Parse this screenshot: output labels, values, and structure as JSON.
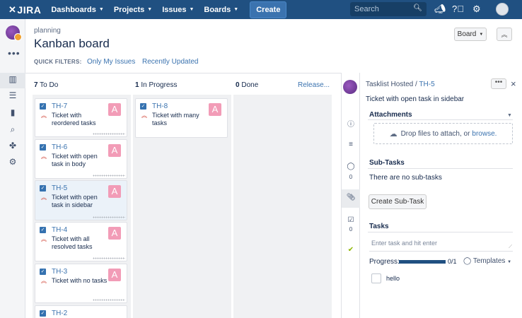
{
  "topnav": {
    "logo": "JIRA",
    "menus": [
      "Dashboards",
      "Projects",
      "Issues",
      "Boards"
    ],
    "create_label": "Create",
    "search_placeholder": "Search"
  },
  "sidebar": {
    "more": "•••"
  },
  "header": {
    "breadcrumb": "planning",
    "title": "Kanban board",
    "quick_filters_label": "QUICK FILTERS:",
    "quick_filters": [
      "Only My Issues",
      "Recently Updated"
    ],
    "board_button": "Board",
    "collapse_icon": "chevrons-up-icon"
  },
  "columns": [
    {
      "count": "7",
      "name": "To Do"
    },
    {
      "count": "1",
      "name": "In Progress"
    },
    {
      "count": "0",
      "name": "Done"
    }
  ],
  "release_link": "Release...",
  "todo_cards": [
    {
      "key": "TH-7",
      "summary": "Ticket with reordered tasks",
      "avatar": "A"
    },
    {
      "key": "TH-6",
      "summary": "Ticket with open task in body",
      "avatar": "A"
    },
    {
      "key": "TH-5",
      "summary": "Ticket with open task in sidebar",
      "avatar": "A"
    },
    {
      "key": "TH-4",
      "summary": "Ticket with all resolved tasks",
      "avatar": "A"
    },
    {
      "key": "TH-3",
      "summary": "Ticket with no tasks",
      "avatar": "A"
    },
    {
      "key": "TH-2",
      "summary": "",
      "avatar": ""
    }
  ],
  "inprogress_cards": [
    {
      "key": "TH-8",
      "summary": "Ticket with many tasks",
      "avatar": "A"
    }
  ],
  "detail": {
    "project": "Tasklist Hosted",
    "separator": "/",
    "issue_key": "TH-5",
    "menu": "•••",
    "close": "×",
    "summary": "Ticket with open task in sidebar",
    "attachments_title": "Attachments",
    "drop_text": "Drop files to attach, or",
    "browse": "browse.",
    "subtasks_title": "Sub-Tasks",
    "no_subtasks": "There are no sub-tasks",
    "create_subtask": "Create Sub-Task",
    "tasks_title": "Tasks",
    "task_placeholder": "Enter task and hit enter",
    "progress_label": "Progress:",
    "progress_value": 0,
    "progress_text": "0/1",
    "templates": "Templates",
    "task_item": "hello",
    "comment_count": "0",
    "checklist_count": "0"
  },
  "colors": {
    "nav": "#205081",
    "link": "#3b73af",
    "avatar": "#f29cb7",
    "priority": "#d04437"
  }
}
